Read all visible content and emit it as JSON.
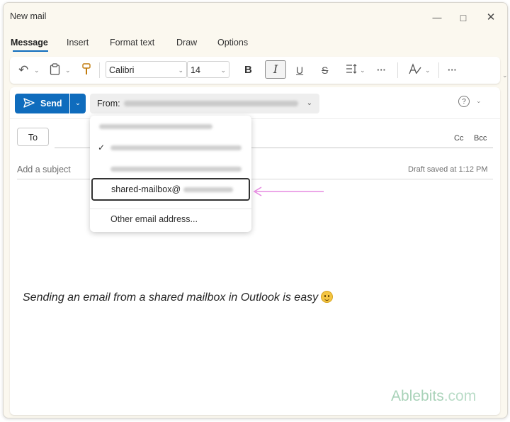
{
  "window": {
    "title": "New mail",
    "minimize_icon": "minimize-icon",
    "maximize_icon": "maximize-icon",
    "close_icon": "close-icon"
  },
  "tabs": [
    {
      "label": "Message",
      "active": true
    },
    {
      "label": "Insert",
      "active": false
    },
    {
      "label": "Format text",
      "active": false
    },
    {
      "label": "Draw",
      "active": false
    },
    {
      "label": "Options",
      "active": false
    }
  ],
  "ribbon": {
    "font_name": "Calibri",
    "font_size": "14",
    "bold_glyph": "B",
    "italic_glyph": "I",
    "underline_glyph": "U",
    "strike_glyph": "S",
    "more_glyph": "···",
    "more2_glyph": "···"
  },
  "compose": {
    "send_label": "Send",
    "from_label": "From:",
    "to_label": "To",
    "cc_label": "Cc",
    "bcc_label": "Bcc",
    "subject_placeholder": "Add a subject",
    "draft_status": "Draft saved at 1:12 PM",
    "body_text": "Sending an email from a shared mailbox in Outlook is easy",
    "brand_name": "Ablebits",
    "brand_domain": ".com"
  },
  "from_dropdown": {
    "selected_account": "shared-mailbox@",
    "other_option": "Other email address..."
  },
  "colors": {
    "accent": "#0f6cbd",
    "arrow": "#e58ae0",
    "brand": "#a8d2b8"
  }
}
